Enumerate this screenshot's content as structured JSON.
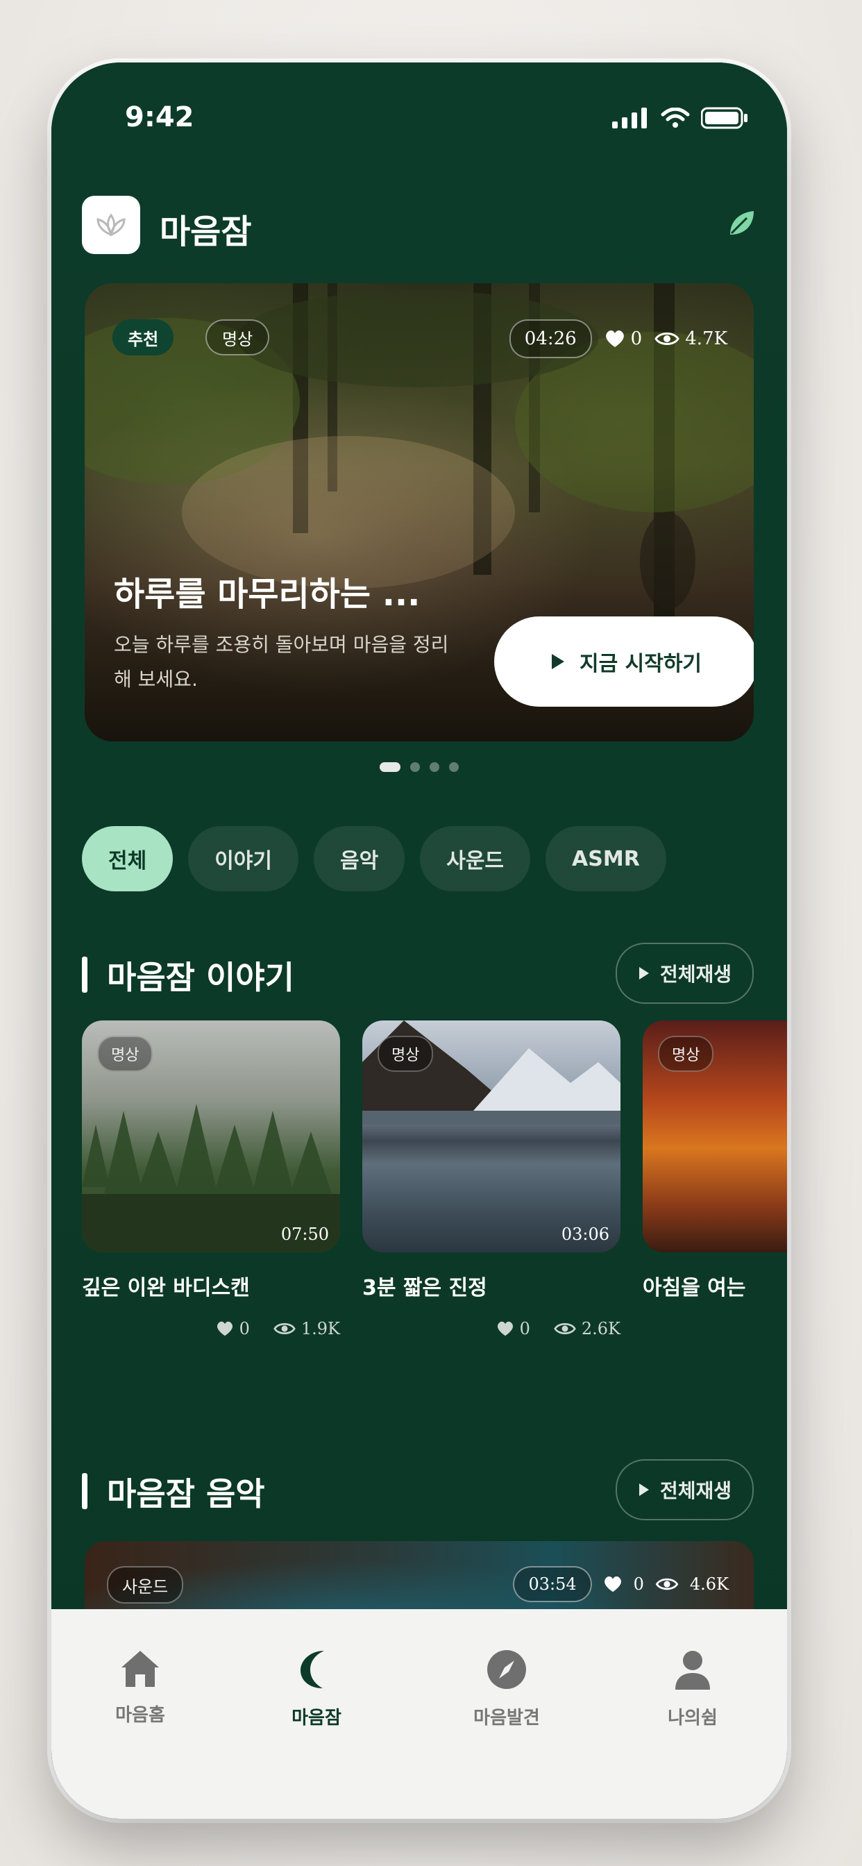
{
  "status_bar": {
    "time": "9:42"
  },
  "header": {
    "app_name": "마음잠"
  },
  "hero": {
    "tag_recommended": "추천",
    "tag_category": "명상",
    "duration": "04:26",
    "likes": "0",
    "views": "4.7K",
    "title": "하루를 마무리하는 ...",
    "description": "오늘 하루를 조용히 돌아보며 마음을 정리해 보세요.",
    "cta_label": "지금 시작하기",
    "page_count": 4,
    "active_page": 1
  },
  "filters": [
    "전체",
    "이야기",
    "음악",
    "사운드",
    "ASMR"
  ],
  "active_filter": 0,
  "section_story": {
    "title": "마음잠 이야기",
    "play_all": "전체재생",
    "cards": [
      {
        "tag": "명상",
        "duration": "07:50",
        "title": "깊은 이완 바디스캔",
        "likes": "0",
        "views": "1.9K"
      },
      {
        "tag": "명상",
        "duration": "03:06",
        "title": "3분 짧은 진정",
        "likes": "0",
        "views": "2.6K"
      },
      {
        "tag": "명상",
        "duration": "",
        "title": "아침을 여는",
        "likes": "",
        "views": ""
      }
    ]
  },
  "section_music": {
    "title": "마음잠 음악",
    "play_all": "전체재생",
    "card": {
      "tag": "사운드",
      "duration": "03:54",
      "likes": "0",
      "views": "4.6K"
    }
  },
  "tabbar": {
    "tabs": [
      {
        "label": "마음홈",
        "icon": "home-icon"
      },
      {
        "label": "마음잠",
        "icon": "moon-icon"
      },
      {
        "label": "마음발견",
        "icon": "compass-icon"
      },
      {
        "label": "나의쉼",
        "icon": "person-icon"
      }
    ],
    "active": 1
  },
  "colors": {
    "background": "#0c3a29",
    "accent": "#a8e3c4",
    "tabbar": "#f3f3f2"
  }
}
